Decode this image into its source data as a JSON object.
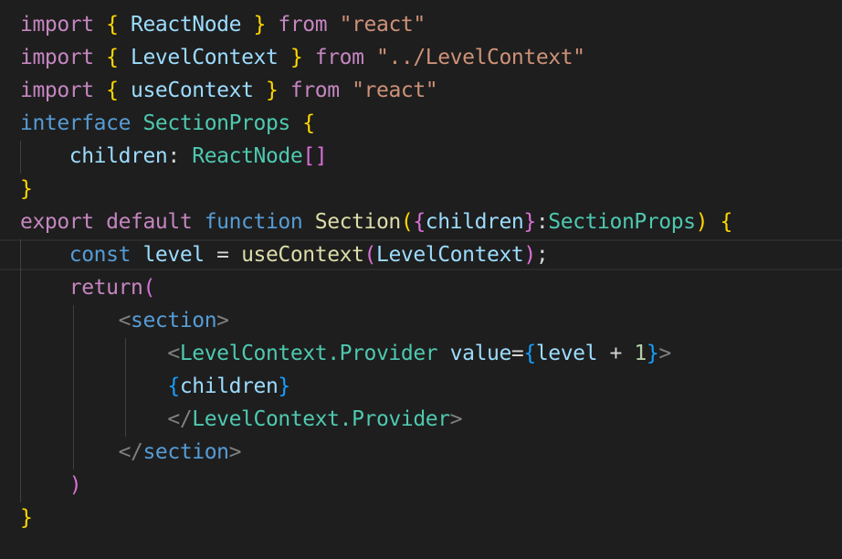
{
  "colors": {
    "background": "#1e1e1e",
    "keyword_control": "#c586c0",
    "keyword_storage": "#569cd6",
    "bracket_gold": "#ffd700",
    "bracket_pink": "#da70d6",
    "bracket_blue": "#179fff",
    "identifier": "#9cdcfe",
    "type": "#4ec9b0",
    "function": "#dcdcaa",
    "string": "#ce9178",
    "number": "#b5cea8",
    "plain": "#d4d4d4",
    "tag_punct": "#808080"
  },
  "code_lines": [
    [
      {
        "t": "import",
        "c": "#c586c0"
      },
      {
        "t": " ",
        "c": "#d4d4d4"
      },
      {
        "t": "{",
        "c": "#ffd700"
      },
      {
        "t": " ReactNode ",
        "c": "#9cdcfe"
      },
      {
        "t": "}",
        "c": "#ffd700"
      },
      {
        "t": " from ",
        "c": "#c586c0"
      },
      {
        "t": "\"react\"",
        "c": "#ce9178"
      }
    ],
    [
      {
        "t": "import",
        "c": "#c586c0"
      },
      {
        "t": " ",
        "c": "#d4d4d4"
      },
      {
        "t": "{",
        "c": "#ffd700"
      },
      {
        "t": " LevelContext ",
        "c": "#9cdcfe"
      },
      {
        "t": "}",
        "c": "#ffd700"
      },
      {
        "t": " from ",
        "c": "#c586c0"
      },
      {
        "t": "\"../LevelContext\"",
        "c": "#ce9178"
      }
    ],
    [
      {
        "t": "import",
        "c": "#c586c0"
      },
      {
        "t": " ",
        "c": "#d4d4d4"
      },
      {
        "t": "{",
        "c": "#ffd700"
      },
      {
        "t": " useContext ",
        "c": "#9cdcfe"
      },
      {
        "t": "}",
        "c": "#ffd700"
      },
      {
        "t": " from ",
        "c": "#c586c0"
      },
      {
        "t": "\"react\"",
        "c": "#ce9178"
      }
    ],
    [
      {
        "t": "interface",
        "c": "#569cd6"
      },
      {
        "t": " SectionProps ",
        "c": "#4ec9b0"
      },
      {
        "t": "{",
        "c": "#ffd700"
      }
    ],
    [
      {
        "t": "    children",
        "c": "#9cdcfe"
      },
      {
        "t": ": ",
        "c": "#d4d4d4"
      },
      {
        "t": "ReactNode",
        "c": "#4ec9b0"
      },
      {
        "t": "[]",
        "c": "#da70d6"
      }
    ],
    [
      {
        "t": "}",
        "c": "#ffd700"
      }
    ],
    [
      {
        "t": "export default",
        "c": "#c586c0"
      },
      {
        "t": " function",
        "c": "#569cd6"
      },
      {
        "t": " Section",
        "c": "#dcdcaa"
      },
      {
        "t": "(",
        "c": "#ffd700"
      },
      {
        "t": "{",
        "c": "#da70d6"
      },
      {
        "t": "children",
        "c": "#9cdcfe"
      },
      {
        "t": "}",
        "c": "#da70d6"
      },
      {
        "t": ":",
        "c": "#d4d4d4"
      },
      {
        "t": "SectionProps",
        "c": "#4ec9b0"
      },
      {
        "t": ")",
        "c": "#ffd700"
      },
      {
        "t": " ",
        "c": "#d4d4d4"
      },
      {
        "t": "{",
        "c": "#ffd700"
      }
    ],
    [
      {
        "t": "    const",
        "c": "#569cd6"
      },
      {
        "t": " level",
        "c": "#9cdcfe"
      },
      {
        "t": " = ",
        "c": "#d4d4d4"
      },
      {
        "t": "useContext",
        "c": "#dcdcaa"
      },
      {
        "t": "(",
        "c": "#da70d6"
      },
      {
        "t": "LevelContext",
        "c": "#9cdcfe"
      },
      {
        "t": ")",
        "c": "#da70d6"
      },
      {
        "t": ";",
        "c": "#d4d4d4"
      }
    ],
    [
      {
        "t": "    return",
        "c": "#c586c0"
      },
      {
        "t": "(",
        "c": "#da70d6"
      }
    ],
    [
      {
        "t": "        <",
        "c": "#808080"
      },
      {
        "t": "section",
        "c": "#569cd6"
      },
      {
        "t": ">",
        "c": "#808080"
      }
    ],
    [
      {
        "t": "            <",
        "c": "#808080"
      },
      {
        "t": "LevelContext.Provider",
        "c": "#4ec9b0"
      },
      {
        "t": " value",
        "c": "#9cdcfe"
      },
      {
        "t": "=",
        "c": "#d4d4d4"
      },
      {
        "t": "{",
        "c": "#179fff"
      },
      {
        "t": "level",
        "c": "#9cdcfe"
      },
      {
        "t": " + ",
        "c": "#d4d4d4"
      },
      {
        "t": "1",
        "c": "#b5cea8"
      },
      {
        "t": "}",
        "c": "#179fff"
      },
      {
        "t": ">",
        "c": "#808080"
      }
    ],
    [
      {
        "t": "            ",
        "c": "#d4d4d4"
      },
      {
        "t": "{",
        "c": "#179fff"
      },
      {
        "t": "children",
        "c": "#9cdcfe"
      },
      {
        "t": "}",
        "c": "#179fff"
      }
    ],
    [
      {
        "t": "            </",
        "c": "#808080"
      },
      {
        "t": "LevelContext.Provider",
        "c": "#4ec9b0"
      },
      {
        "t": ">",
        "c": "#808080"
      }
    ],
    [
      {
        "t": "        </",
        "c": "#808080"
      },
      {
        "t": "section",
        "c": "#569cd6"
      },
      {
        "t": ">",
        "c": "#808080"
      }
    ],
    [
      {
        "t": "    )",
        "c": "#da70d6"
      }
    ],
    [
      {
        "t": "}",
        "c": "#ffd700"
      }
    ]
  ]
}
